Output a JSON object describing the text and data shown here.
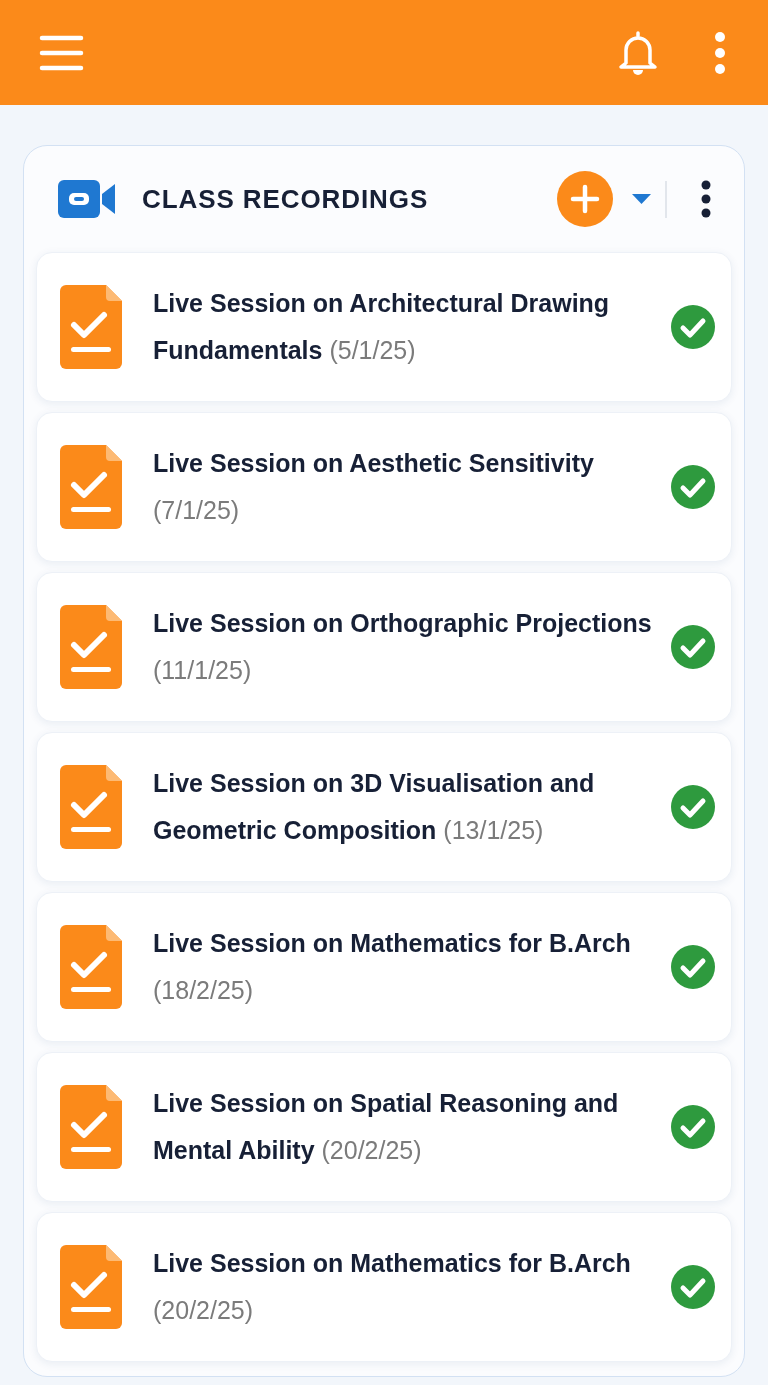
{
  "panel": {
    "title": "CLASS RECORDINGS"
  },
  "recordings": [
    {
      "title": "Live Session on Architectural Drawing Fundamentals",
      "date": "(5/1/25)",
      "completed": true
    },
    {
      "title": "Live Session on Aesthetic Sensitivity",
      "date": "(7/1/25)",
      "completed": true
    },
    {
      "title": "Live Session on Orthographic Projections",
      "date": "(11/1/25)",
      "completed": true
    },
    {
      "title": "Live Session on 3D Visualisation and Geometric Composition",
      "date": "(13/1/25)",
      "completed": true
    },
    {
      "title": "Live Session on Mathematics for B.Arch",
      "date": "(18/2/25)",
      "completed": true
    },
    {
      "title": "Live Session on Spatial Reasoning and Mental Ability",
      "date": "(20/2/25)",
      "completed": true
    },
    {
      "title": "Live Session on Mathematics for B.Arch",
      "date": "(20/2/25)",
      "completed": true
    }
  ]
}
